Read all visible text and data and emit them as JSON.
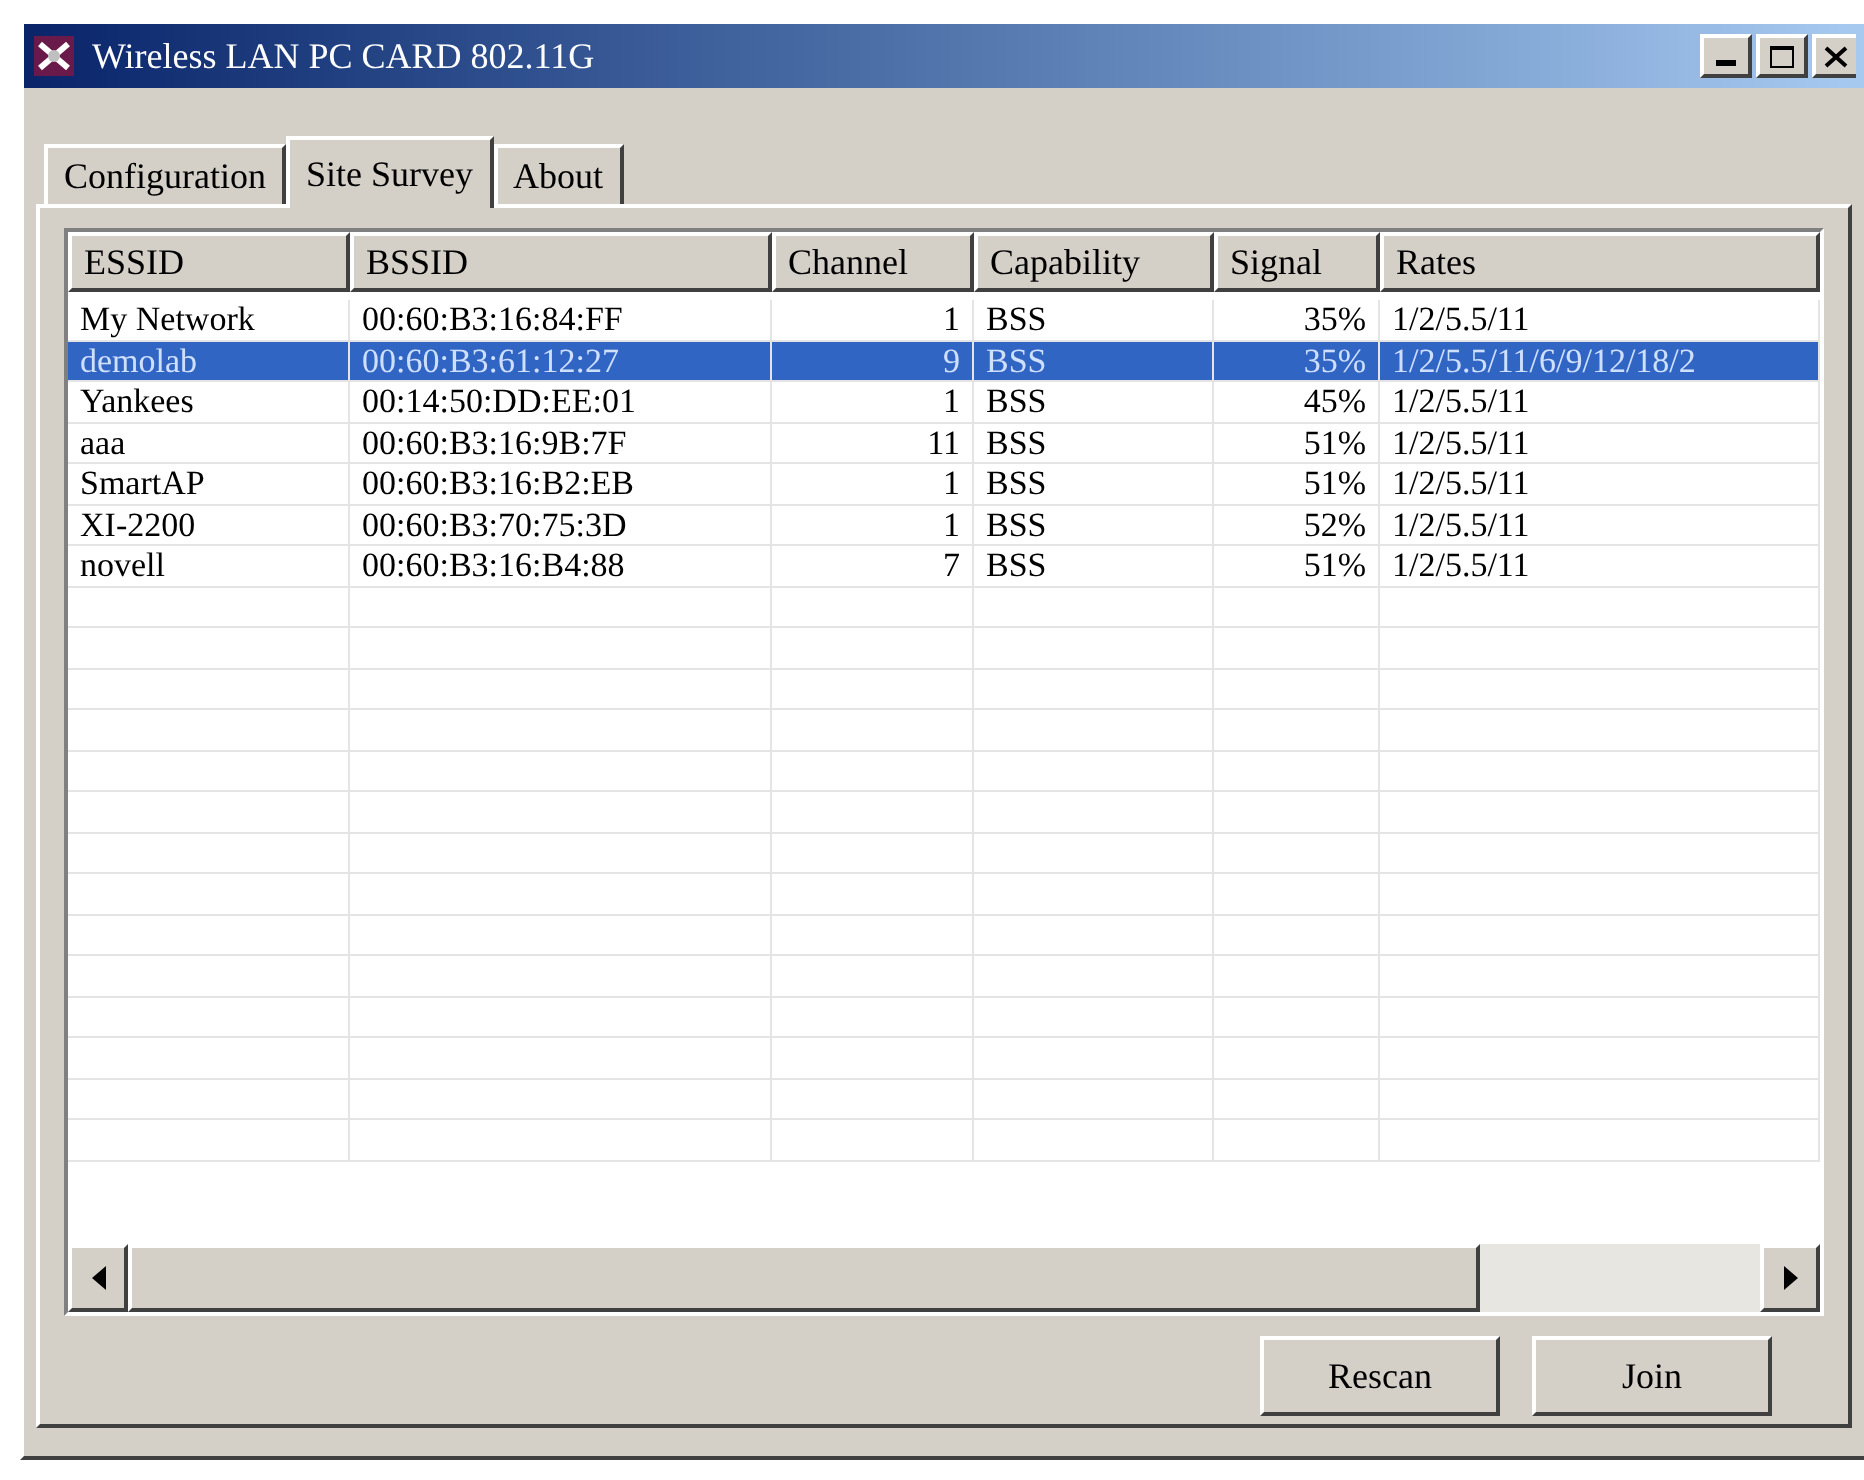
{
  "window": {
    "title": "Wireless LAN PC CARD 802.11G"
  },
  "tabs": [
    {
      "label": "Configuration",
      "selected": false
    },
    {
      "label": "Site Survey",
      "selected": true
    },
    {
      "label": "About",
      "selected": false
    }
  ],
  "table": {
    "columns": [
      "ESSID",
      "BSSID",
      "Channel",
      "Capability",
      "Signal",
      "Rates"
    ],
    "rows": [
      {
        "cells": [
          "My Network",
          "00:60:B3:16:84:FF",
          "1",
          "BSS",
          "35%",
          "1/2/5.5/11"
        ],
        "selected": false
      },
      {
        "cells": [
          "demolab",
          "00:60:B3:61:12:27",
          "9",
          "BSS",
          "35%",
          "1/2/5.5/11/6/9/12/18/2"
        ],
        "selected": true
      },
      {
        "cells": [
          "Yankees",
          "00:14:50:DD:EE:01",
          "1",
          "BSS",
          "45%",
          "1/2/5.5/11"
        ],
        "selected": false
      },
      {
        "cells": [
          "aaa",
          "00:60:B3:16:9B:7F",
          "11",
          "BSS",
          "51%",
          "1/2/5.5/11"
        ],
        "selected": false
      },
      {
        "cells": [
          "SmartAP",
          "00:60:B3:16:B2:EB",
          "1",
          "BSS",
          "51%",
          "1/2/5.5/11"
        ],
        "selected": false
      },
      {
        "cells": [
          "XI-2200",
          "00:60:B3:70:75:3D",
          "1",
          "BSS",
          "52%",
          "1/2/5.5/11"
        ],
        "selected": false
      },
      {
        "cells": [
          "novell",
          "00:60:B3:16:B4:88",
          "7",
          "BSS",
          "51%",
          "1/2/5.5/11"
        ],
        "selected": false
      }
    ]
  },
  "buttons": [
    "Rescan",
    "Join"
  ]
}
